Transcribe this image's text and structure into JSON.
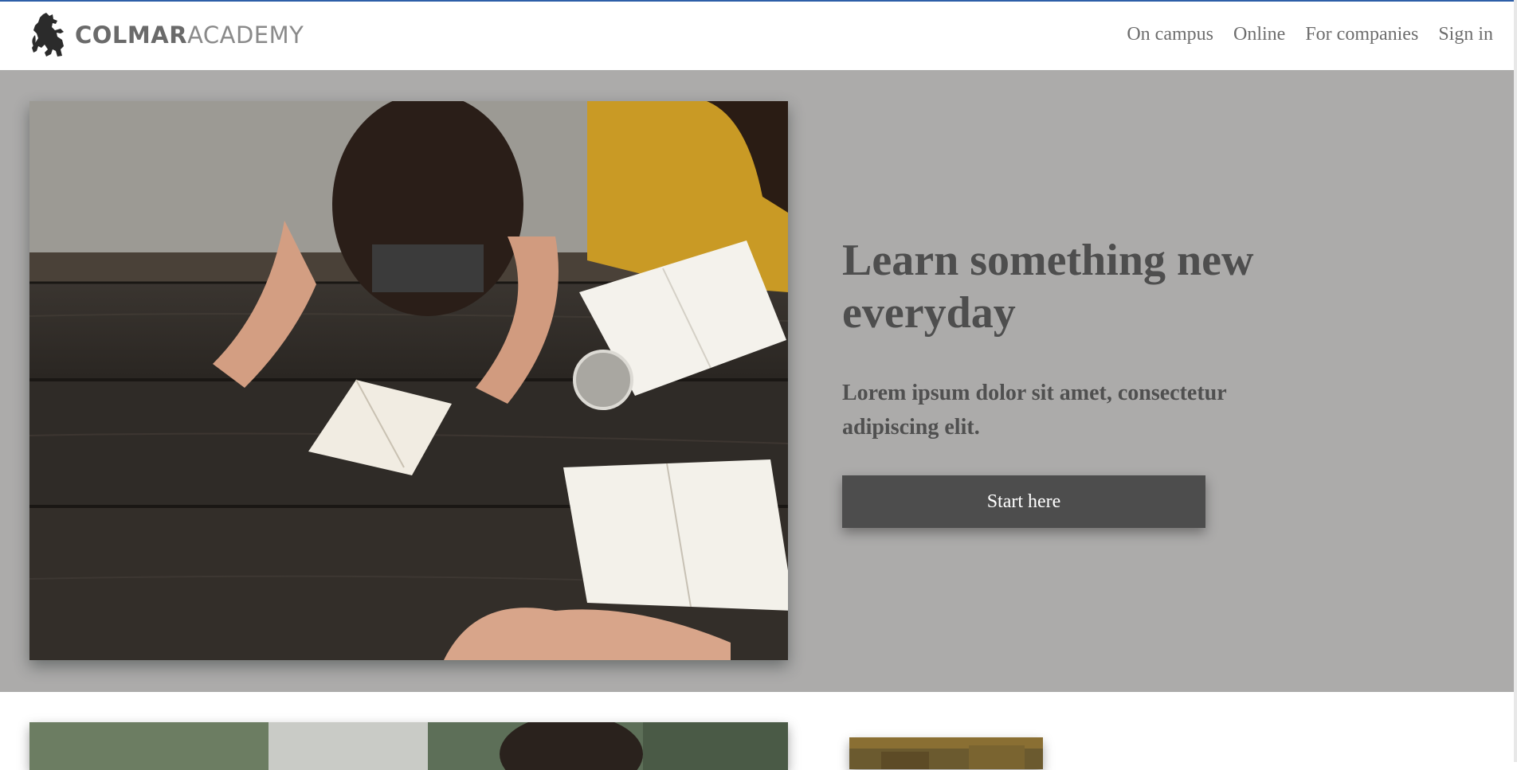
{
  "header": {
    "logo": {
      "brand_bold": "COLMAR",
      "brand_light": "ACADEMY",
      "icon": "lion-rampant-icon"
    },
    "nav": [
      {
        "label": "On campus"
      },
      {
        "label": "Online"
      },
      {
        "label": "For companies"
      },
      {
        "label": "Sign in"
      }
    ]
  },
  "hero": {
    "title": "Learn something new everyday",
    "subtitle": "Lorem ipsum dolor sit amet, consectetur adipiscing elit.",
    "cta_label": "Start here",
    "background_color": "#acabaa",
    "button_color": "#4d4d4d"
  },
  "colors": {
    "accent": "#2e5fa8",
    "text_dark": "#4e4e4e",
    "nav_text": "#6d6d6d"
  }
}
